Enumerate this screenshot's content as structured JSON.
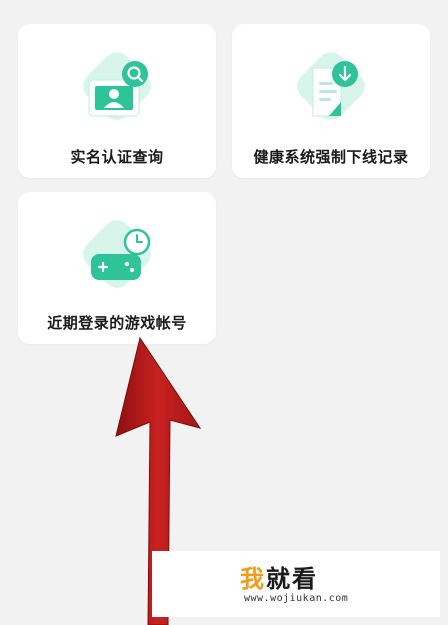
{
  "cards": [
    {
      "label": "实名认证查询",
      "icon": "id-card-search-icon"
    },
    {
      "label": "健康系统强制下线记录",
      "icon": "document-download-icon"
    },
    {
      "label": "近期登录的游戏帐号",
      "icon": "gamepad-clock-icon"
    }
  ],
  "watermark": {
    "title_part1": "我",
    "title_part2": "就看",
    "url": "www.wojiukan.com"
  },
  "colors": {
    "accent_green": "#2fc39a",
    "accent_light": "#d8f5ec",
    "arrow_red": "#c11f1f",
    "watermark_orange": "#f39c1a"
  }
}
